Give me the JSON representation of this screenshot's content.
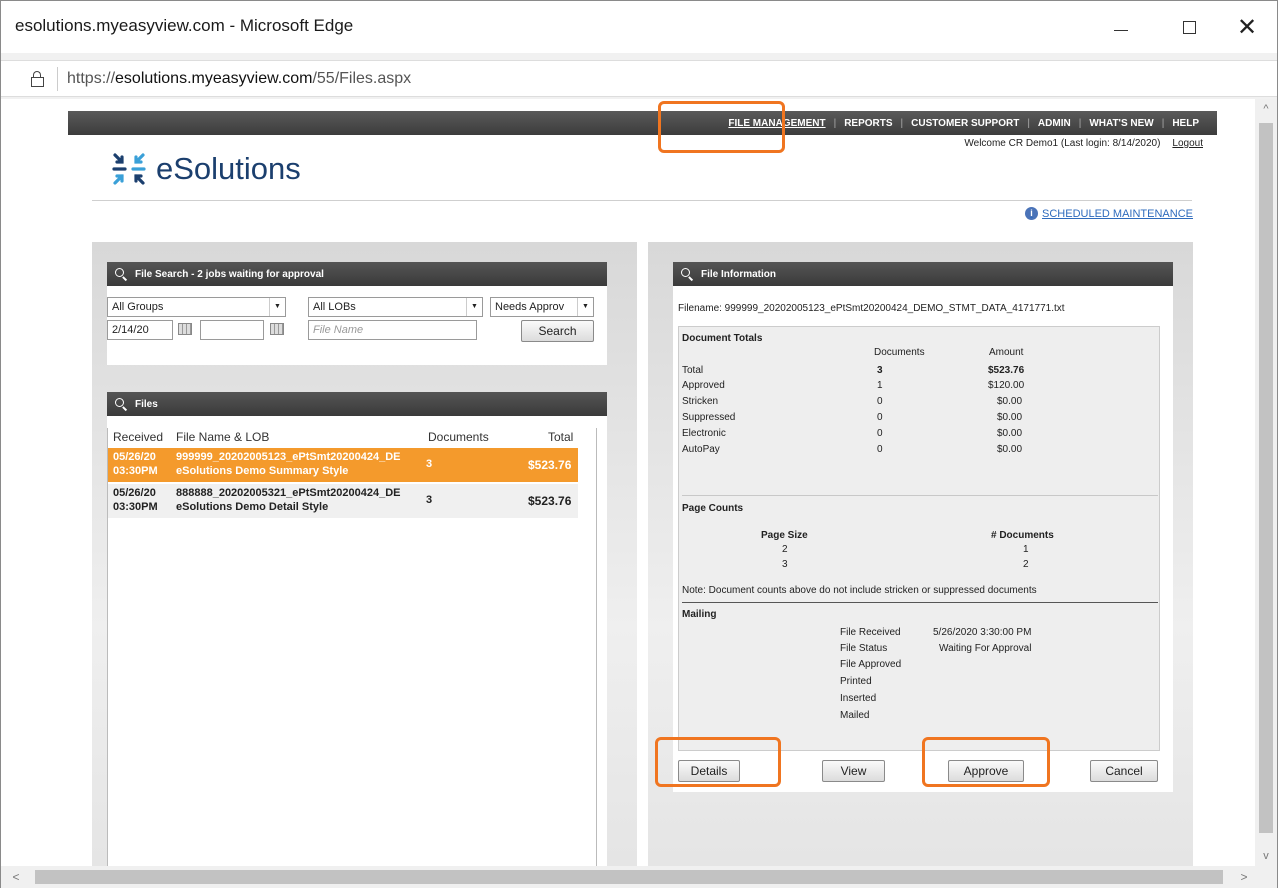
{
  "window": {
    "title": "esolutions.myeasyview.com - Microsoft Edge",
    "url_prefix": "https://",
    "url_domain": "esolutions.myeasyview.com",
    "url_path": "/55/Files.aspx"
  },
  "nav": {
    "items": [
      "FILE MANAGEMENT",
      "REPORTS",
      "CUSTOMER SUPPORT",
      "ADMIN",
      "WHAT'S NEW",
      "HELP"
    ],
    "divider": "|",
    "welcome": "Welcome CR Demo1 (Last login: 8/14/2020)",
    "logout": "Logout"
  },
  "logo": {
    "wordmark": "eSolutions",
    "colors": [
      "#1b3f6e",
      "#3aa0d8"
    ]
  },
  "maintenance": {
    "label": "SCHEDULED MAINTENANCE",
    "icon_glyph": "i"
  },
  "file_search": {
    "title": "File Search - 2 jobs waiting for approval",
    "groups": "All Groups",
    "lobs": "All LOBs",
    "status": "Needs Approv",
    "date": "2/14/20",
    "date2": "",
    "file_name_placeholder": "File Name",
    "search_label": "Search"
  },
  "files": {
    "title": "Files",
    "columns": [
      "Received",
      "File Name & LOB",
      "Documents",
      "Total"
    ],
    "rows": [
      {
        "date": "05/26/20",
        "time": "03:30PM",
        "name": "999999_20202005123_ePtSmt20200424_DE",
        "lob": "eSolutions Demo Summary Style",
        "documents": "3",
        "total": "$523.76"
      },
      {
        "date": "05/26/20",
        "time": "03:30PM",
        "name": "888888_20202005321_ePtSmt20200424_DE",
        "lob": "eSolutions Demo Detail Style",
        "documents": "3",
        "total": "$523.76"
      }
    ]
  },
  "file_info": {
    "title": "File Information",
    "filename": "Filename: 999999_20202005123_ePtSmt20200424_DEMO_STMT_DATA_4171771.txt",
    "doc_totals_heading": "Document Totals",
    "doc_columns": [
      "Documents",
      "Amount"
    ],
    "doc_rows": [
      {
        "label": "Total",
        "documents": "3",
        "amount": "$523.76"
      },
      {
        "label": "Approved",
        "documents": "1",
        "amount": "$120.00"
      },
      {
        "label": "Stricken",
        "documents": "0",
        "amount": "$0.00"
      },
      {
        "label": "Suppressed",
        "documents": "0",
        "amount": "$0.00"
      },
      {
        "label": "Electronic",
        "documents": "0",
        "amount": "$0.00"
      },
      {
        "label": "AutoPay",
        "documents": "0",
        "amount": "$0.00"
      }
    ],
    "page_counts_heading": "Page Counts",
    "page_columns": [
      "Page Size",
      "# Documents"
    ],
    "page_rows": [
      {
        "size": "2",
        "docs": "1"
      },
      {
        "size": "3",
        "docs": "2"
      }
    ],
    "note": "Note: Document counts above do not include stricken or suppressed documents",
    "mailing_heading": "Mailing",
    "mailing_rows": [
      {
        "label": "File Received",
        "value": "5/26/2020 3:30:00 PM"
      },
      {
        "label": "File Status",
        "value": "Waiting For Approval"
      },
      {
        "label": "File Approved",
        "value": ""
      },
      {
        "label": "Printed",
        "value": ""
      },
      {
        "label": "Inserted",
        "value": ""
      },
      {
        "label": "Mailed",
        "value": ""
      }
    ],
    "buttons": {
      "details": "Details",
      "view": "View",
      "approve": "Approve",
      "cancel": "Cancel"
    }
  },
  "colors": {
    "highlight": "#f07520",
    "selected_row": "#f49a2c",
    "nav_bg": "#444444",
    "link": "#2e6bbd"
  }
}
